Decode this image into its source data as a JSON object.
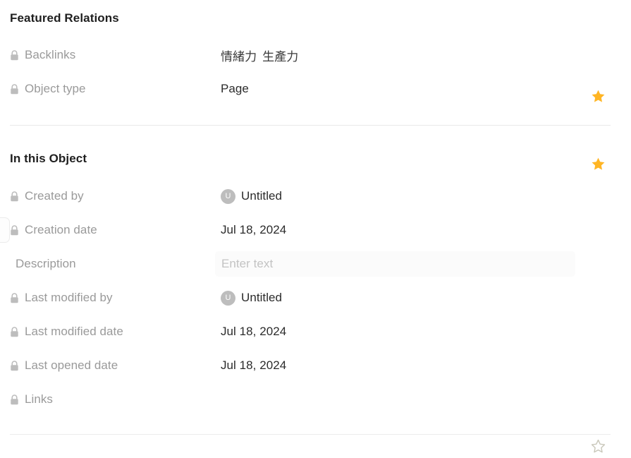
{
  "colors": {
    "star_filled": "#FFB524",
    "star_outline": "#c9c7ba",
    "label_text": "#9a9a9a",
    "value_text": "#2b2b2b",
    "heading_text": "#1f1f1f",
    "divider": "#e8e8e8",
    "avatar_bg": "#bdbdbd",
    "field_bg": "#fbfbfb",
    "placeholder": "#c3c3c3"
  },
  "sections": [
    {
      "id": "featured-relations",
      "heading": "Featured Relations",
      "rows": [
        {
          "name": "backlinks",
          "label": "Backlinks",
          "locked": true,
          "lock_icon": "lock-icon",
          "value_type": "backlinks",
          "backlinks": [
            "情緒力",
            "生產力"
          ],
          "star": "filled",
          "star_icon": "star-filled-icon"
        },
        {
          "name": "object-type",
          "label": "Object type",
          "locked": true,
          "lock_icon": "lock-icon",
          "value_type": "text",
          "value": "Page",
          "star": "filled",
          "star_icon": "star-filled-icon"
        }
      ]
    },
    {
      "id": "in-this-object",
      "heading": "In this Object",
      "rows": [
        {
          "name": "created-by",
          "label": "Created by",
          "locked": true,
          "lock_icon": "lock-icon",
          "value_type": "avatar",
          "avatar_initial": "U",
          "value": "Untitled",
          "star": "none"
        },
        {
          "name": "creation-date",
          "label": "Creation date",
          "locked": true,
          "lock_icon": "lock-icon",
          "value_type": "text",
          "value": "Jul 18, 2024",
          "star": "outline",
          "star_icon": "star-outline-icon",
          "highlighted": true
        },
        {
          "name": "description",
          "label": "Description",
          "locked": false,
          "value_type": "input",
          "value": "",
          "placeholder": "Enter text",
          "star": "none"
        },
        {
          "name": "last-modified-by",
          "label": "Last modified by",
          "locked": true,
          "lock_icon": "lock-icon",
          "value_type": "avatar",
          "avatar_initial": "U",
          "value": "Untitled",
          "star": "none"
        },
        {
          "name": "last-modified-date",
          "label": "Last modified date",
          "locked": true,
          "lock_icon": "lock-icon",
          "value_type": "text",
          "value": "Jul 18, 2024",
          "star": "none"
        },
        {
          "name": "last-opened-date",
          "label": "Last opened date",
          "locked": true,
          "lock_icon": "lock-icon",
          "value_type": "text",
          "value": "Jul 18, 2024",
          "star": "none"
        },
        {
          "name": "links",
          "label": "Links",
          "locked": true,
          "lock_icon": "lock-icon",
          "value_type": "empty",
          "value": "",
          "star": "none"
        }
      ]
    }
  ]
}
